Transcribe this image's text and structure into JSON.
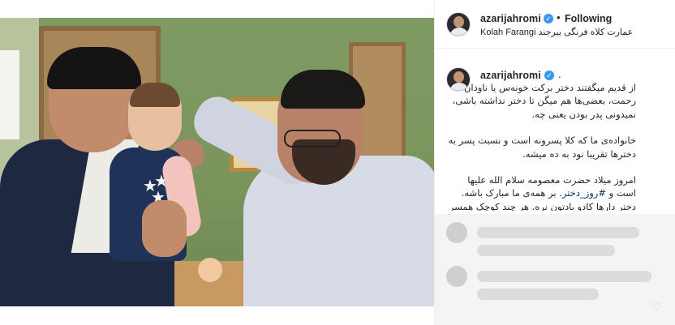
{
  "header": {
    "username": "azarijahromi",
    "verified_icon": "verified-badge-icon",
    "separator": "•",
    "follow_state": "Following",
    "location": "Kolah Farangi عمارت کلاه فرنگی بیرجند"
  },
  "caption": {
    "username": "azarijahromi",
    "trailing_char": ".",
    "paragraphs": [
      "از قدیم میگفتند دختر برکت خونه‌س یا ناودان رحمت، بعضی‌ها هم میگن تا دختر نداشته باشی، نمیدونی پدر بودن یعنی چه.",
      "خانواده‌ی ما که کلا پسرونه است و نسبت پسر به دخترها تقریبا نود به ده میشه."
    ],
    "p3_before": "امروز میلاد حضرت معصومه سلام الله علیها است و",
    "hashtag": "#روز_دختر",
    "p3_after": ". بر همه‌ی ما مبارک باشه. دختر دارها کادو یادتون نره. هر چند کوچک همسر انتون، هم فراموش نکنید یک وقت، منم از"
  },
  "comments": {
    "like_icon": "heart-icon"
  },
  "colors": {
    "verified": "#3897f0",
    "hashtag": "#003569",
    "text": "#262626",
    "border": "#efefef"
  }
}
